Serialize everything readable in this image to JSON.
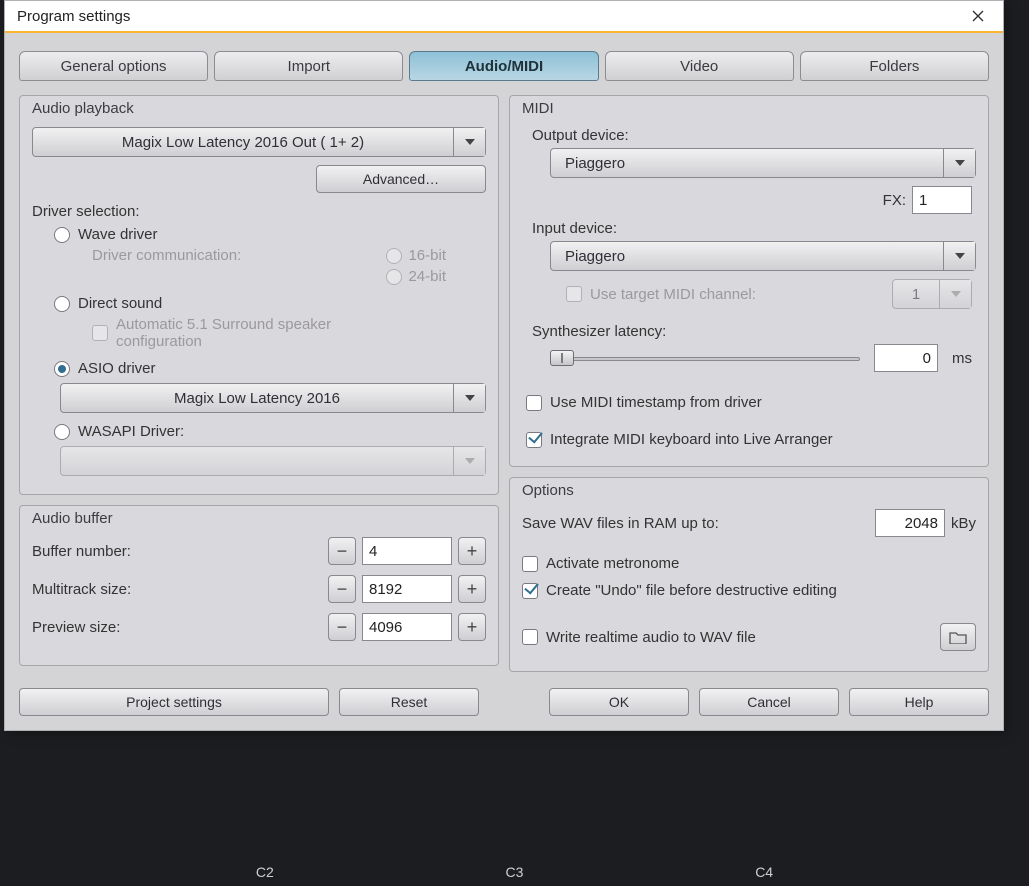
{
  "window": {
    "title": "Program settings"
  },
  "tabs": {
    "items": [
      "General options",
      "Import",
      "Audio/MIDI",
      "Video",
      "Folders"
    ],
    "active": 2
  },
  "audio_playback": {
    "title": "Audio playback",
    "device": "Magix Low Latency 2016 Out ( 1+ 2)",
    "advanced": "Advanced…",
    "driver_selection": "Driver selection:",
    "wave_driver": "Wave driver",
    "driver_comm": "Driver communication:",
    "bit16": "16-bit",
    "bit24": "24-bit",
    "direct_sound": "Direct sound",
    "auto51": "Automatic 5.1 Surround speaker configuration",
    "asio_driver": "ASIO driver",
    "asio_device": "Magix Low Latency 2016",
    "wasapi": "WASAPI Driver:"
  },
  "audio_buffer": {
    "title": "Audio buffer",
    "buffer_number_label": "Buffer number:",
    "buffer_number": "4",
    "multitrack_label": "Multitrack size:",
    "multitrack": "8192",
    "preview_label": "Preview size:",
    "preview": "4096"
  },
  "midi": {
    "title": "MIDI",
    "output_label": "Output device:",
    "output_device": "Piaggero",
    "fx_label": "FX:",
    "fx_value": "1",
    "input_label": "Input device:",
    "input_device": "Piaggero",
    "use_target": "Use target MIDI channel:",
    "target_channel": "1",
    "synth_latency_label": "Synthesizer latency:",
    "synth_latency": "0",
    "synth_unit": "ms",
    "use_timestamp": "Use MIDI timestamp from driver",
    "integrate": "Integrate MIDI keyboard into Live Arranger"
  },
  "options": {
    "title": "Options",
    "save_wav_label": "Save WAV files in RAM up to:",
    "save_wav_value": "2048",
    "save_wav_unit": "kBy",
    "metronome": "Activate metronome",
    "undo": "Create \"Undo\" file before destructive editing",
    "realtime": "Write realtime audio to WAV file"
  },
  "buttons": {
    "project_settings": "Project settings",
    "reset": "Reset",
    "ok": "OK",
    "cancel": "Cancel",
    "help": "Help"
  },
  "keys": {
    "c2": "C2",
    "c3": "C3",
    "c4": "C4"
  }
}
